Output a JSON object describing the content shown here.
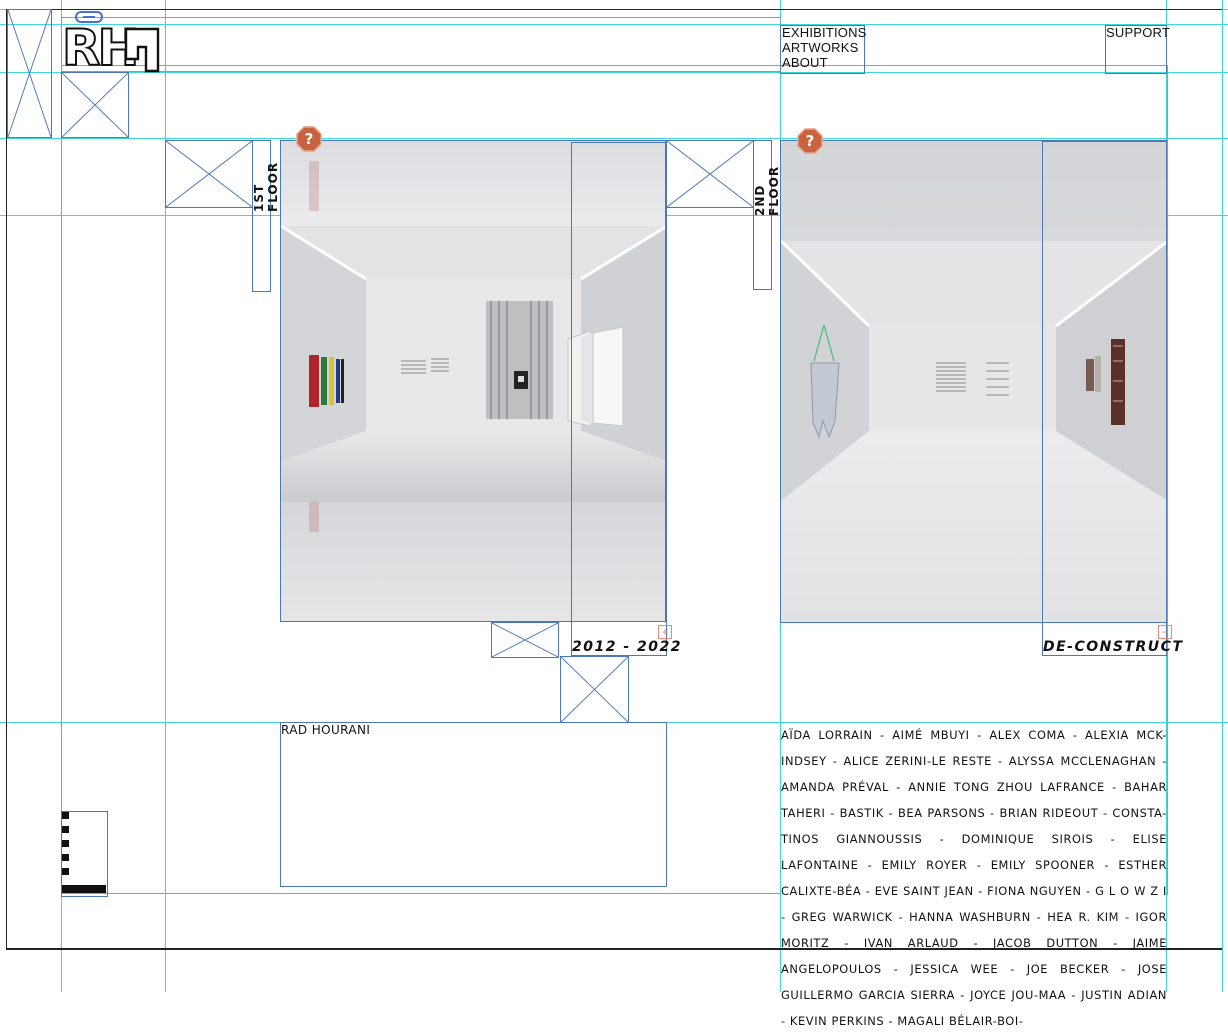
{
  "brand": {
    "logo_text": "RH"
  },
  "nav": {
    "items": [
      {
        "label": "EXHIBITIONS"
      },
      {
        "label": "ARTWORKS"
      },
      {
        "label": "ABOUT"
      }
    ],
    "support_label": "SUPPORT"
  },
  "floors": [
    {
      "label": "1ST FLOOR",
      "caption": "2012 - 2022",
      "help_icon": "question-octagon-icon"
    },
    {
      "label": "2ND FLOOR",
      "caption": "DE-CONSTRUCT",
      "help_icon": "question-octagon-icon"
    }
  ],
  "artist_block": {
    "name": "RAD HOURANI"
  },
  "artists_text": "AÏDA LORRAIN - AIMÉ MBUYI - ALEX COMA - ALEXIA MCK-INDSEY - ALICE ZERINI-LE RESTE - ALYSSA MCCLENAGHAN - AMANDA PRÉVAL - ANNIE TONG ZHOU LAFRANCE - BAHAR TAHERI - BASTIK - BEA PARSONS - BRIAN RIDEOUT - CONSTA-TINOS GIANNOUSSIS - DOMINIQUE SIROIS - ELISE LAFONTAINE - EMILY ROYER - EMILY SPOONER - ESTHER CALIXTE-BÉA - EVE SAINT JEAN - FIONA NGUYEN - G L O W Z I - GREG WARWICK - HANNA WASHBURN - HEA R. KIM - IGOR MORITZ - IVAN ARLAUD - JACOB DUTTON - JAIME ANGELOPOULOS - JESSICA WEE - JOE BECKER - JOSE GUILLERMO GARCIA SIERRA - JOYCE JOU-MAA - JUSTIN ADIAN - KEVIN PERKINS - MAGALI BÉLAIR-BOI-",
  "colors": {
    "guide": "#3fd6dc",
    "frame": "#4a78b8",
    "accent_purple": "#c67ad9",
    "badge": "#c8623f"
  }
}
